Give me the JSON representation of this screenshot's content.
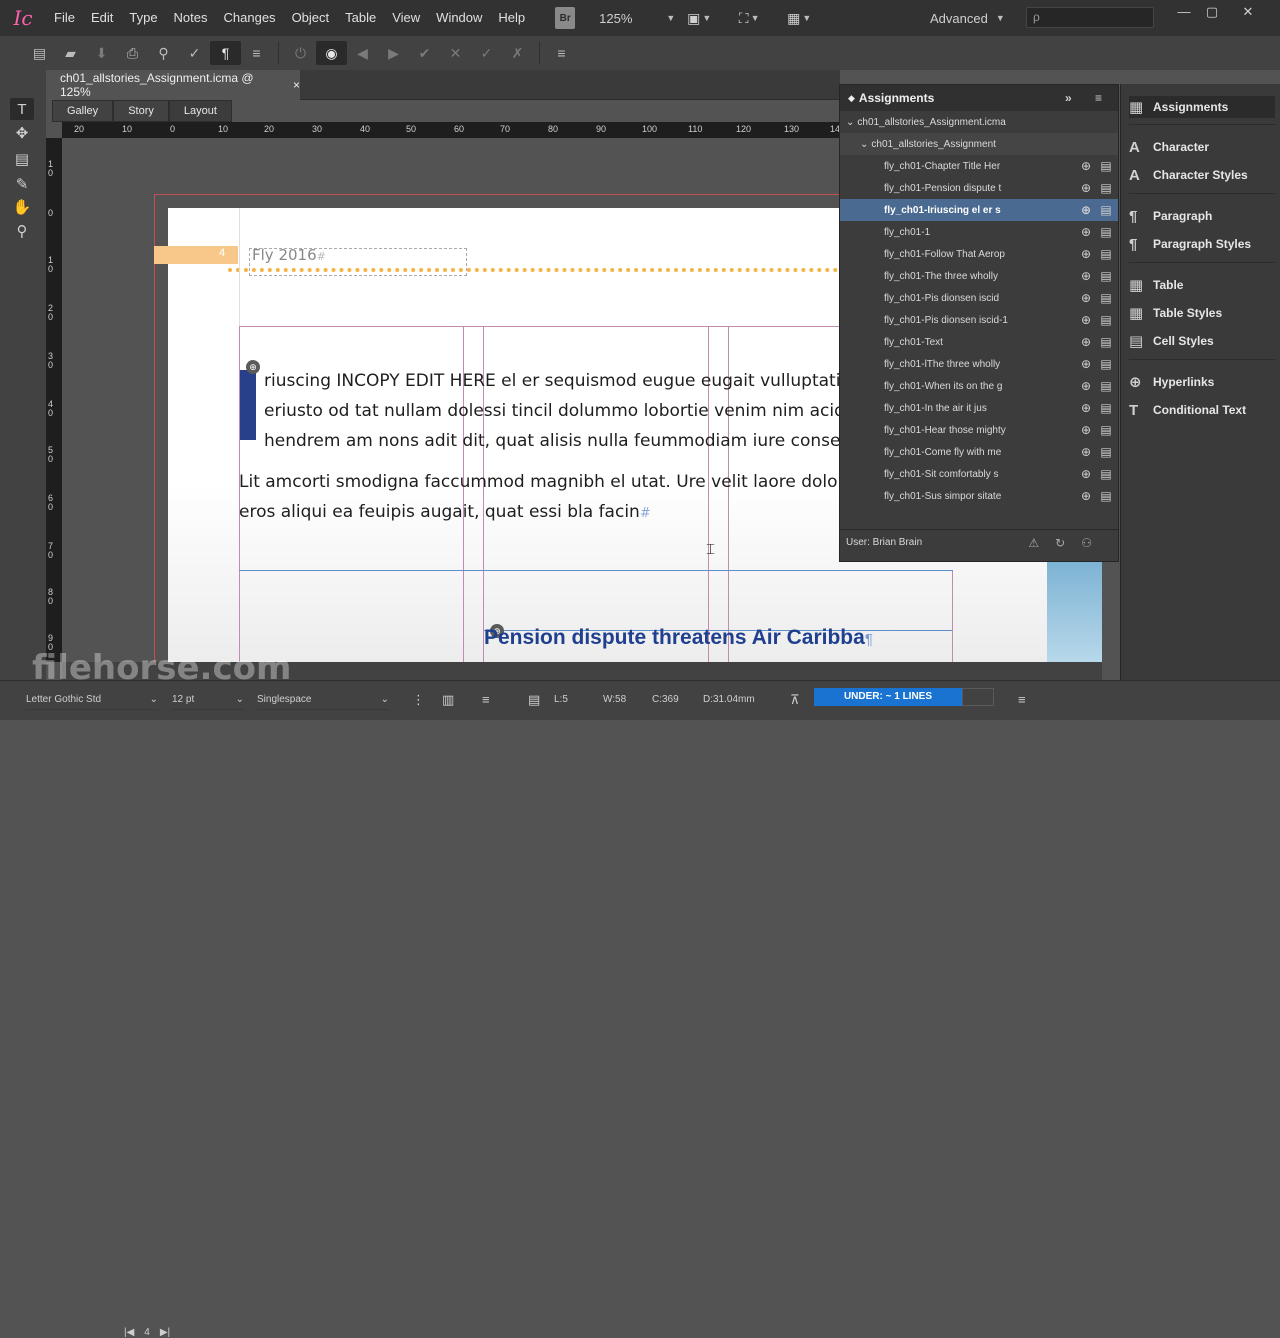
{
  "app": {
    "logo": "Ic",
    "window_controls": [
      "—",
      "▢",
      "✕"
    ]
  },
  "menubar": {
    "items": [
      "File",
      "Edit",
      "Type",
      "Notes",
      "Changes",
      "Object",
      "Table",
      "View",
      "Window",
      "Help"
    ],
    "bridge_badge": "Br",
    "zoom": "125%",
    "workspace": "Advanced",
    "search_placeholder": "ρ"
  },
  "toolbar": {
    "icons": [
      "new-icon",
      "open-icon",
      "save-icon",
      "print-icon",
      "find-icon",
      "spellcheck-icon",
      "pilcrow-icon",
      "menu-icon",
      "power-icon",
      "eye-icon",
      "prev-icon",
      "next-icon",
      "accept-icon",
      "reject-icon",
      "accept-all-icon",
      "reject-all-icon",
      "more-icon"
    ]
  },
  "document": {
    "tab_title": "ch01_allstories_Assignment.icma @ 125%",
    "close_glyph": "×",
    "views": [
      "Galley",
      "Story",
      "Layout"
    ],
    "active_view": "Layout",
    "ruler_h": [
      "20",
      "10",
      "0",
      "10",
      "20",
      "30",
      "40",
      "50",
      "60",
      "70",
      "80",
      "90",
      "100",
      "110",
      "120",
      "130",
      "14"
    ],
    "ruler_v": [
      "1 0",
      "0",
      "1 0",
      "2 0",
      "3 0",
      "4 0",
      "5 0",
      "6 0",
      "7 0",
      "8 0",
      "9 0"
    ],
    "folio": "4",
    "header_text": "Fly 2016",
    "header_mark": "#",
    "body_lines_1": [
      "riuscing INCOPY EDIT HERE el er sequismod eugue eugait vulluptatie d",
      "eriusto od tat nullam dolessi tincil dolummo lobortie venim nim acidu",
      "hendrem am nons adit dit, quat alisis nulla feummodiam iure conse co"
    ],
    "body_lines_2": [
      "Lit amcorti smodigna faccummod magnibh el utat. Ure velit laore dolore",
      "eros aliqui ea feuipis augait, quat essi bla facin"
    ],
    "body_end_mark": "#",
    "headline": "Pension dispute threatens Air Caribba",
    "headline_mark": "¶",
    "page_number": "4"
  },
  "assignments_panel": {
    "title": "Assignments",
    "file": "ch01_allstories_Assignment.icma",
    "assignment": "ch01_allstories_Assignment",
    "stories": [
      "fly_ch01-Chapter Title Her",
      "fly_ch01-Pension dispute t",
      "fly_ch01-Iriuscing el er s",
      "fly_ch01-1",
      "fly_ch01-Follow That Aerop",
      "fly_ch01-The three wholly",
      "fly_ch01-Pis dionsen iscid",
      "fly_ch01-Pis dionsen iscid-1",
      "fly_ch01-Text",
      "fly_ch01-lThe three wholly",
      "fly_ch01-When its on the g",
      "fly_ch01-In the air it jus",
      "fly_ch01-Hear those mighty",
      "fly_ch01-Come fly with me",
      "fly_ch01-Sit comfortably s",
      "fly_ch01-Sus simpor sitate"
    ],
    "selected_index": 2,
    "user": "User: Brian Brain"
  },
  "dock": {
    "items": [
      {
        "label": "Assignments",
        "icon": "assignments-icon"
      },
      {
        "label": "Character",
        "icon": "character-icon"
      },
      {
        "label": "Character Styles",
        "icon": "character-styles-icon"
      },
      {
        "label": "Paragraph",
        "icon": "paragraph-icon"
      },
      {
        "label": "Paragraph Styles",
        "icon": "paragraph-styles-icon"
      },
      {
        "label": "Table",
        "icon": "table-icon"
      },
      {
        "label": "Table Styles",
        "icon": "table-styles-icon"
      },
      {
        "label": "Cell Styles",
        "icon": "cell-styles-icon"
      },
      {
        "label": "Hyperlinks",
        "icon": "hyperlinks-icon"
      },
      {
        "label": "Conditional Text",
        "icon": "conditional-text-icon"
      }
    ]
  },
  "statusbar": {
    "font": "Letter Gothic Std",
    "size": "12 pt",
    "spacing": "Singlespace",
    "line": "L:5",
    "words": "W:58",
    "chars": "C:369",
    "depth": "D:31.04mm",
    "overset": "UNDER:  ~ 1 LINES"
  },
  "watermark": "filehorse.com",
  "colors": {
    "accent": "#1a73d0",
    "selection": "#4a6a92",
    "headline": "#1f3f8f",
    "folio": "#f8c78a"
  }
}
